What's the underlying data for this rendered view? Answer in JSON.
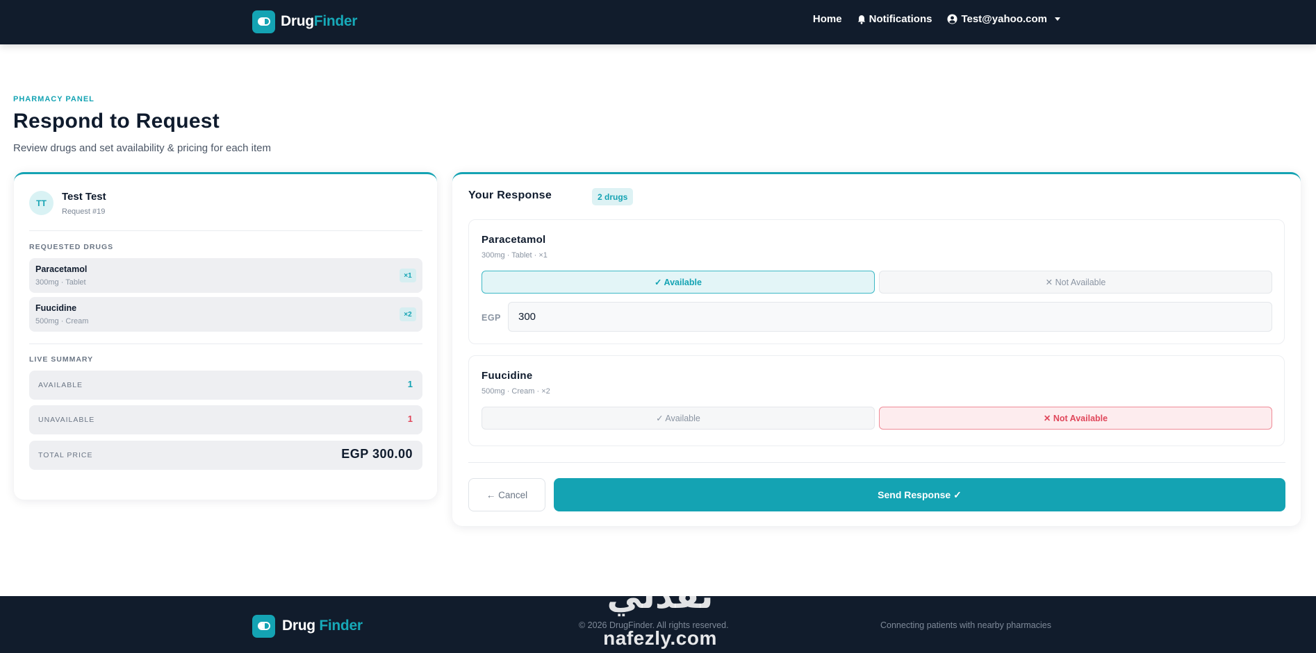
{
  "nav": {
    "brand_drug": "Drug",
    "brand_finder": "Finder",
    "home": "Home",
    "notifications": "Notifications",
    "user_email": "Test@yahoo.com"
  },
  "header": {
    "eyebrow": "PHARMACY PANEL",
    "title": "Respond to Request",
    "subtitle": "Review drugs and set availability & pricing for each item"
  },
  "request": {
    "initials": "TT",
    "name": "Test Test",
    "id_label": "Request #19",
    "requested_label": "REQUESTED DRUGS",
    "drugs": [
      {
        "name": "Paracetamol",
        "meta": "300mg · Tablet",
        "qty": "×1"
      },
      {
        "name": "Fuucidine",
        "meta": "500mg · Cream",
        "qty": "×2"
      }
    ],
    "summary_label": "LIVE SUMMARY",
    "summary": {
      "available_label": "AVAILABLE",
      "available_value": "1",
      "unavailable_label": "UNAVAILABLE",
      "unavailable_value": "1",
      "total_label": "TOTAL PRICE",
      "total_value": "EGP 300.00"
    }
  },
  "response": {
    "title": "Your Response",
    "badge": "2 drugs",
    "items": [
      {
        "name": "Paracetamol",
        "meta": "300mg · Tablet · ×1",
        "available_label": "✓ Available",
        "not_available_label": "✕ Not Available",
        "status": "available",
        "price_currency": "EGP",
        "price_value": "300"
      },
      {
        "name": "Fuucidine",
        "meta": "500mg · Cream · ×2",
        "available_label": "✓ Available",
        "not_available_label": "✕ Not Available",
        "status": "not_available"
      }
    ],
    "cancel_label": "← Cancel",
    "send_label": "Send Response ✓"
  },
  "footer": {
    "brand_drug": "Drug",
    "brand_finder": "Finder",
    "copyright": "© 2026 DrugFinder. All rights reserved.",
    "tagline": "Connecting patients with nearby pharmacies"
  },
  "watermark": {
    "arabic": "نفذلي",
    "latin": "nafezly.com"
  },
  "colors": {
    "navbar_bg": "#111c2c",
    "accent": "#14a3b3",
    "danger": "#e0475b"
  }
}
